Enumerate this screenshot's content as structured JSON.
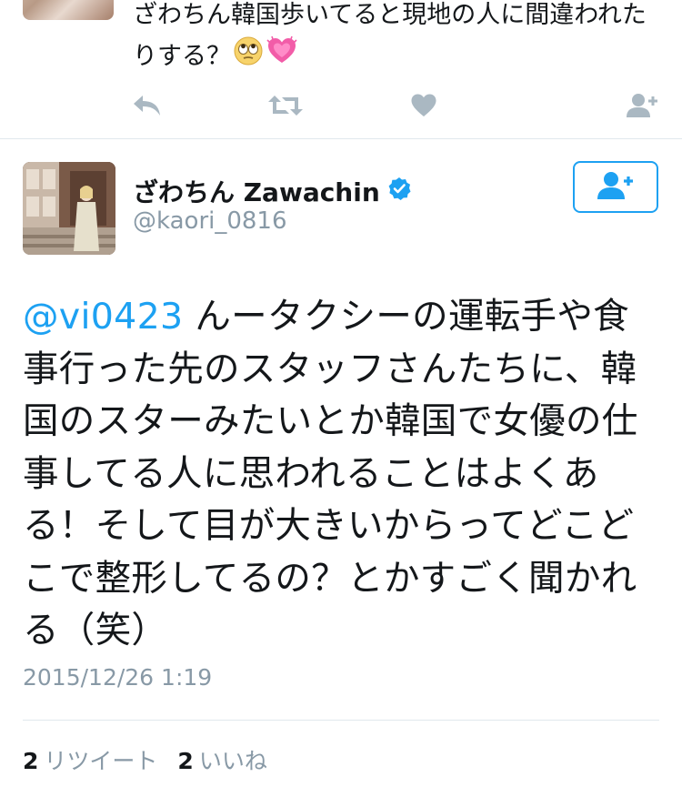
{
  "previous_tweet": {
    "text": "ざわちん韓国歩いてると現地の人に間違われたりする？",
    "emojis": [
      "face-with-rolling-eyes",
      "growing-heart"
    ]
  },
  "actions": {
    "icons": [
      "reply-icon",
      "retweet-icon",
      "like-icon",
      "follow-icon"
    ]
  },
  "tweet": {
    "display_name": "ざわちん Zawachin",
    "handle": "@kaori_0816",
    "mention": "@vi0423",
    "body": " んータクシーの運転手や食事行った先のスタッフさんたちに、韓国のスターみたいとか韓国で女優の仕事してる人に思われることはよくある！そして目が大きいからってどこどこで整形してるの？とかすごく聞かれる（笑）",
    "timestamp": "2015/12/26 1:19",
    "retweet_count": "2",
    "retweet_label": "リツイート",
    "like_count": "2",
    "like_label": "いいね"
  },
  "colors": {
    "accent": "#1da1f2",
    "muted": "#8899a6",
    "icon": "#aab8c2",
    "text": "#14171a"
  }
}
